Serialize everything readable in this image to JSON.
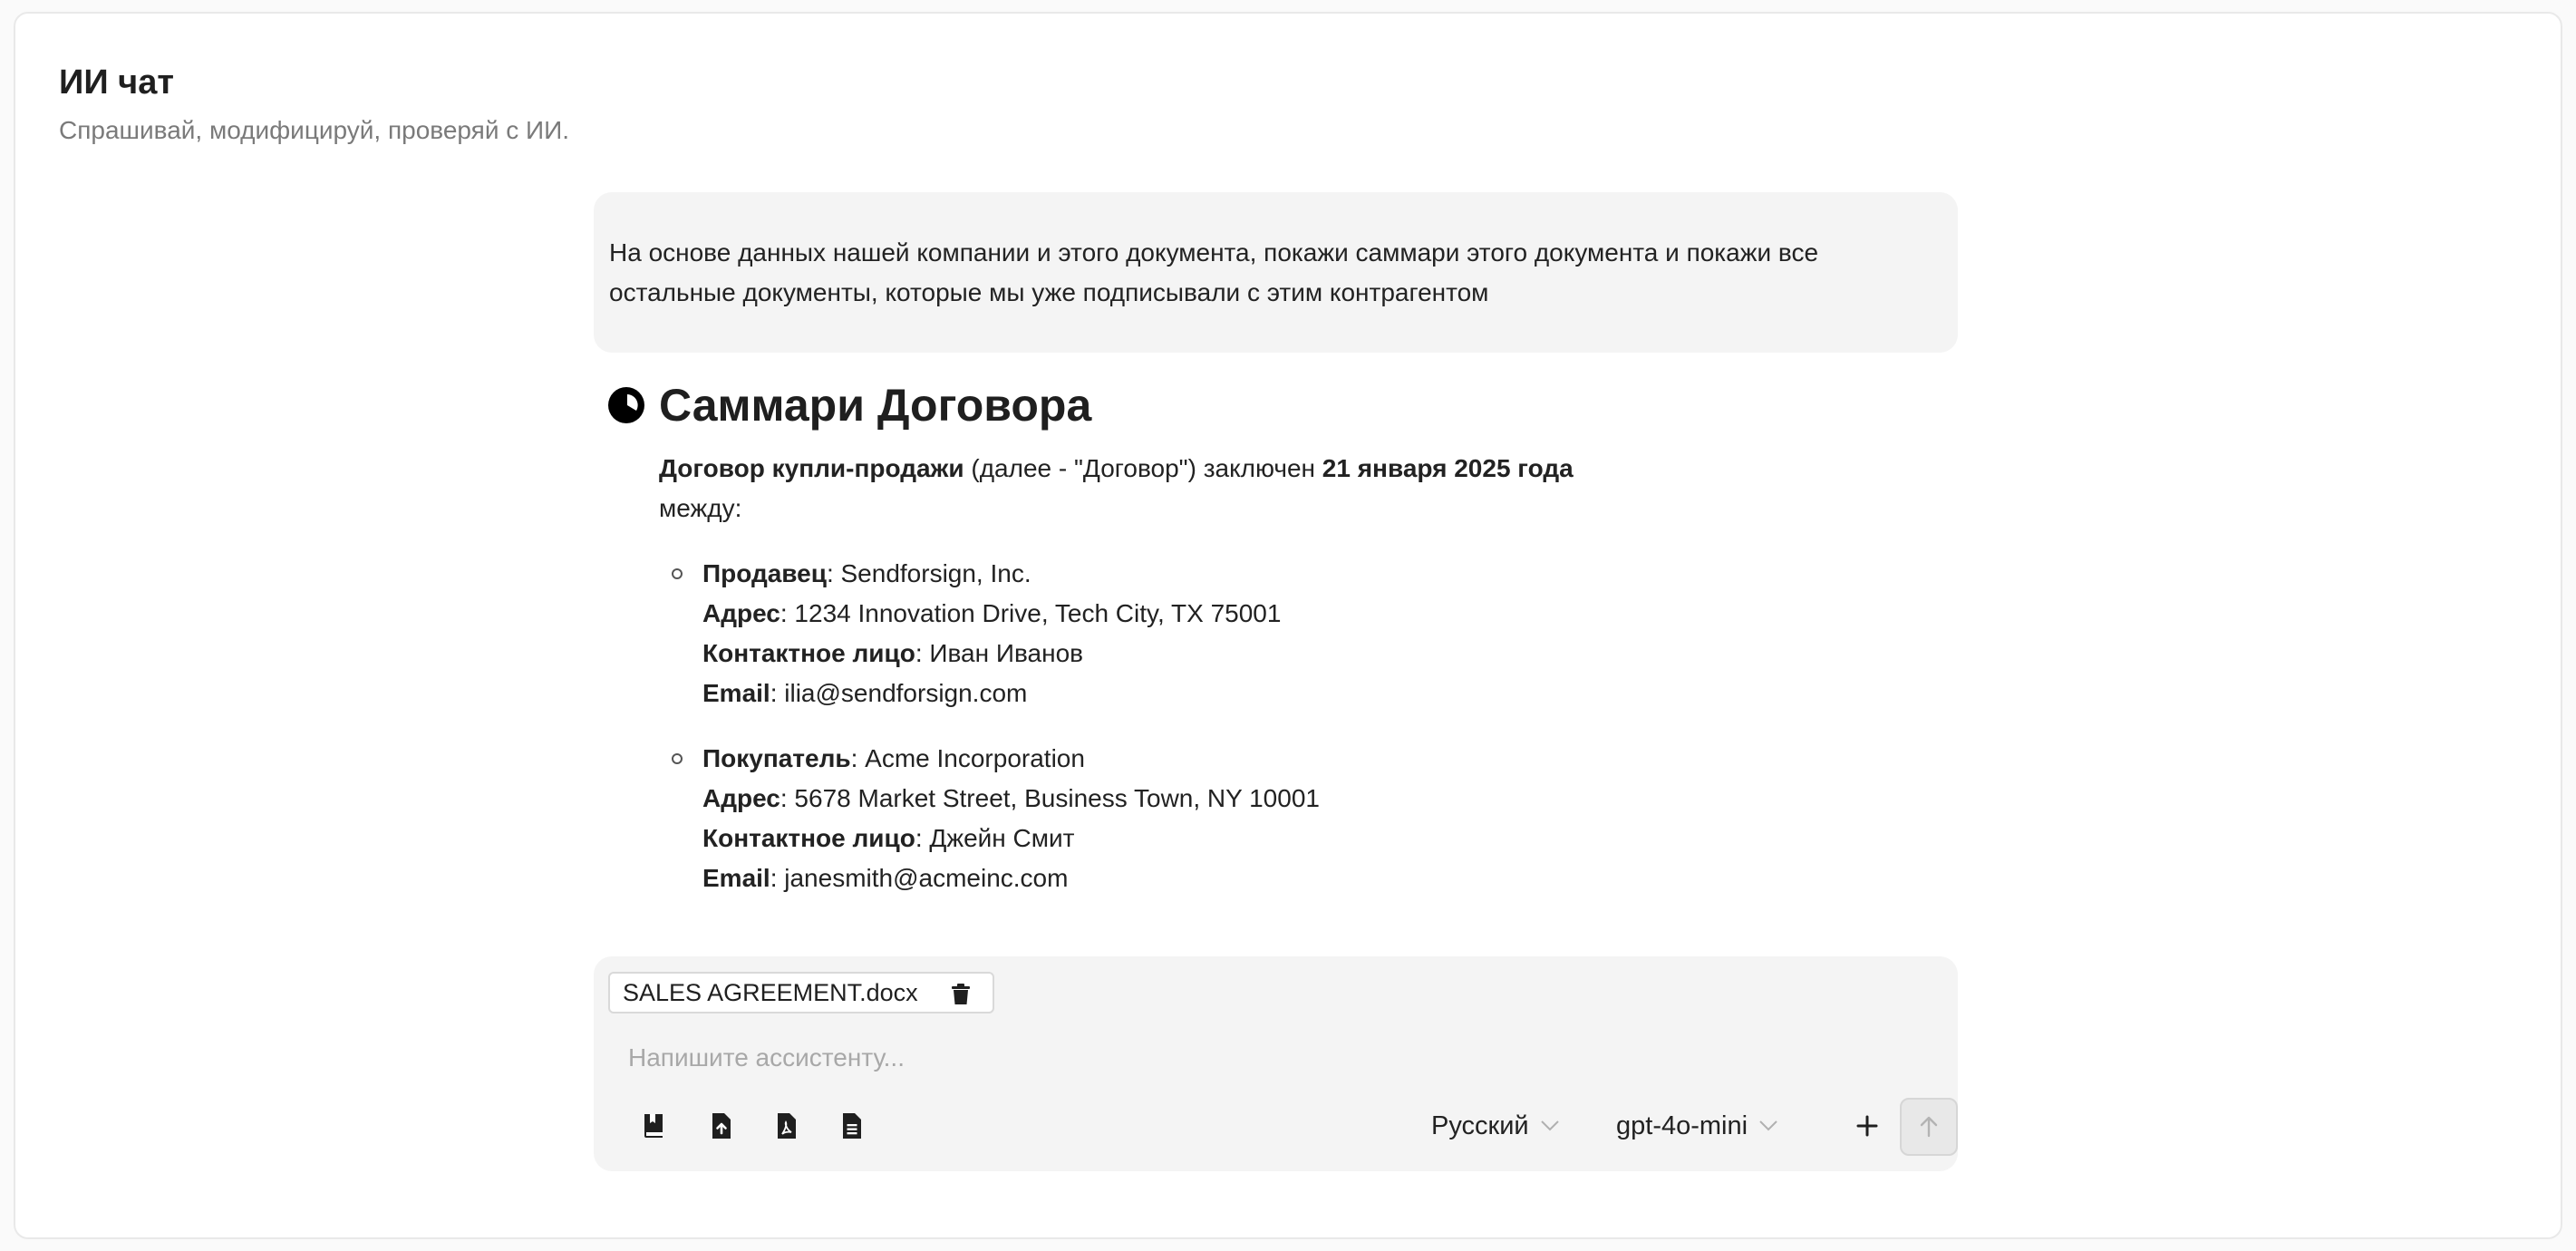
{
  "header": {
    "title": "ИИ чат",
    "subtitle": "Спрашивай, модифицируй, проверяй с ИИ."
  },
  "user_message": "На основе данных нашей компании и этого документа, покажи саммари этого документа и покажи все остальные документы, которые мы уже подписывали с этим контрагентом",
  "assistant": {
    "icon": "pie-chart-icon",
    "title": "Саммари Договора",
    "intro": {
      "contract_name": "Договор купли-продажи",
      "middle": " (далее - \"Договор\") заключен ",
      "date": "21 января 2025 года",
      "tail": "между:"
    },
    "parties": [
      {
        "role_label": "Продавец",
        "role_value": ": Sendforsign, Inc.",
        "address_label": "Адрес",
        "address_value": ": 1234 Innovation Drive, Tech City, TX 75001",
        "contact_label": "Контактное лицо",
        "contact_value": ": Иван Иванов",
        "email_label": "Email",
        "email_value": ": ilia@sendforsign.com"
      },
      {
        "role_label": "Покупатель",
        "role_value": ": Acme Incorporation",
        "address_label": "Адрес",
        "address_value": ": 5678 Market Street, Business Town, NY 10001",
        "contact_label": "Контактное лицо",
        "contact_value": ": Джейн Смит",
        "email_label": "Email",
        "email_value": ": janesmith@acmeinc.com"
      }
    ]
  },
  "composer": {
    "attachment_name": "SALES AGREEMENT.docx",
    "placeholder": "Напишите ассистенту...",
    "tools": [
      "book-icon",
      "file-upload-icon",
      "pdf-file-icon",
      "document-icon"
    ],
    "language": "Русский",
    "model": "gpt-4o-mini",
    "icons": {
      "add": "plus-icon",
      "send": "arrow-up-icon",
      "delete": "trash-icon"
    }
  }
}
